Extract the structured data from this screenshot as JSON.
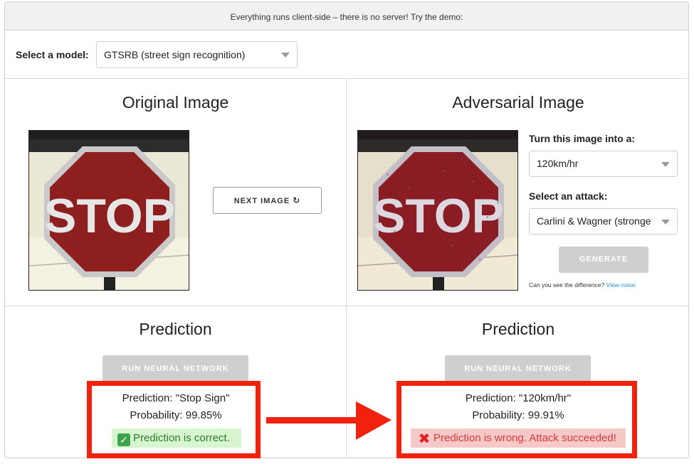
{
  "banner": "Everything runs client-side – there is no server! Try the demo:",
  "model": {
    "label": "Select a model:",
    "selected": "GTSRB (street sign recognition)"
  },
  "original": {
    "title": "Original Image",
    "image_text": "STOP",
    "next_button": "NEXT IMAGE"
  },
  "adversarial": {
    "title": "Adversarial Image",
    "image_text": "STOP",
    "target_label": "Turn this image into a:",
    "target_selected": "120km/hr",
    "attack_label": "Select an attack:",
    "attack_selected": "Carlini & Wagner (stronge",
    "generate_button": "GENERATE",
    "note_text": "Can you see the difference?",
    "note_link": "View noise."
  },
  "prediction_left": {
    "title": "Prediction",
    "run_button": "RUN NEURAL NETWORK",
    "prediction": "Prediction: \"Stop Sign\"",
    "probability": "Probability: 99.85%",
    "status": "Prediction is correct.",
    "status_icon": "check-icon"
  },
  "prediction_right": {
    "title": "Prediction",
    "run_button": "RUN NEURAL NETWORK",
    "prediction": "Prediction: \"120km/hr\"",
    "probability": "Probability: 99.91%",
    "status": "Prediction is wrong. Attack succeeded!",
    "status_icon": "cross-icon"
  },
  "colors": {
    "highlight_red": "#f0220e",
    "correct_bg": "#d7f5cf",
    "wrong_bg": "#f6c8c8",
    "link_blue": "#2a8fd8"
  }
}
